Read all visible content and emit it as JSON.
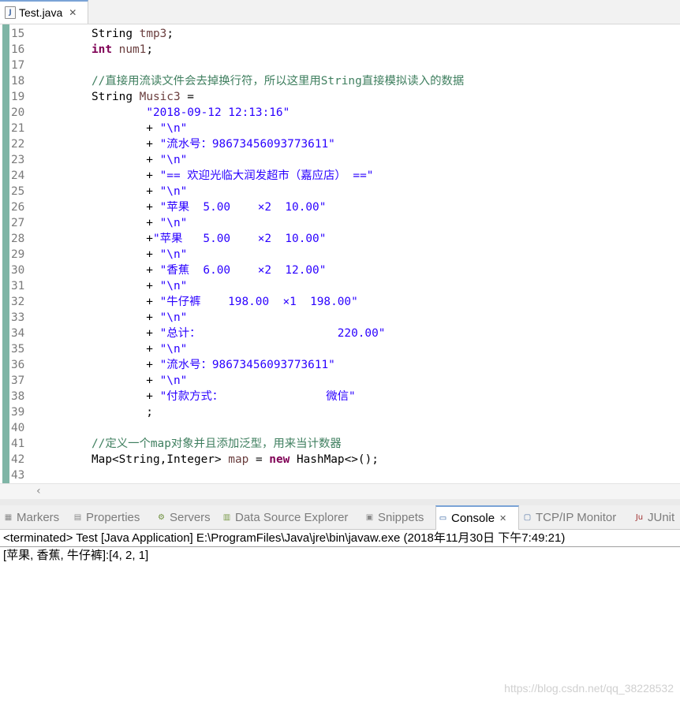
{
  "editor_tab": {
    "label": "Test.java",
    "close": "✕"
  },
  "code_lines": [
    {
      "n": "15",
      "segs": [
        {
          "t": "String ",
          "c": ""
        },
        {
          "t": "tmp3",
          "c": "fld"
        },
        {
          "t": ";",
          "c": ""
        }
      ]
    },
    {
      "n": "16",
      "segs": [
        {
          "t": "int",
          "c": "kw"
        },
        {
          "t": " ",
          "c": ""
        },
        {
          "t": "num1",
          "c": "fld"
        },
        {
          "t": ";",
          "c": ""
        }
      ]
    },
    {
      "n": "17",
      "segs": []
    },
    {
      "n": "18",
      "segs": [
        {
          "t": "//直接用流读文件会去掉换行符，所以这里用String直接模拟读入的数据",
          "c": "cmt"
        }
      ]
    },
    {
      "n": "19",
      "segs": [
        {
          "t": "String ",
          "c": ""
        },
        {
          "t": "Music3",
          "c": "fld"
        },
        {
          "t": " =",
          "c": ""
        }
      ]
    },
    {
      "n": "20",
      "segs": [
        {
          "t": "        ",
          "c": ""
        },
        {
          "t": "\"2018-09-12 12:13:16\"",
          "c": "str"
        }
      ]
    },
    {
      "n": "21",
      "segs": [
        {
          "t": "        + ",
          "c": ""
        },
        {
          "t": "\"\\n\"",
          "c": "str"
        }
      ]
    },
    {
      "n": "22",
      "segs": [
        {
          "t": "        + ",
          "c": ""
        },
        {
          "t": "\"流水号：98673456093773611\"",
          "c": "str"
        }
      ]
    },
    {
      "n": "23",
      "segs": [
        {
          "t": "        + ",
          "c": ""
        },
        {
          "t": "\"\\n\"",
          "c": "str"
        }
      ]
    },
    {
      "n": "24",
      "segs": [
        {
          "t": "        + ",
          "c": ""
        },
        {
          "t": "\"== 欢迎光临大润发超市（嘉应店） ==\"",
          "c": "str"
        }
      ]
    },
    {
      "n": "25",
      "segs": [
        {
          "t": "        + ",
          "c": ""
        },
        {
          "t": "\"\\n\"",
          "c": "str"
        }
      ]
    },
    {
      "n": "26",
      "segs": [
        {
          "t": "        + ",
          "c": ""
        },
        {
          "t": "\"苹果  5.00    ×2  10.00\"",
          "c": "str"
        }
      ]
    },
    {
      "n": "27",
      "segs": [
        {
          "t": "        + ",
          "c": ""
        },
        {
          "t": "\"\\n\"",
          "c": "str"
        }
      ]
    },
    {
      "n": "28",
      "segs": [
        {
          "t": "        +",
          "c": ""
        },
        {
          "t": "\"苹果   5.00    ×2  10.00\"",
          "c": "str"
        }
      ]
    },
    {
      "n": "29",
      "segs": [
        {
          "t": "        + ",
          "c": ""
        },
        {
          "t": "\"\\n\"",
          "c": "str"
        }
      ]
    },
    {
      "n": "30",
      "segs": [
        {
          "t": "        + ",
          "c": ""
        },
        {
          "t": "\"香蕉  6.00    ×2  12.00\"",
          "c": "str"
        }
      ]
    },
    {
      "n": "31",
      "segs": [
        {
          "t": "        + ",
          "c": ""
        },
        {
          "t": "\"\\n\"",
          "c": "str"
        }
      ]
    },
    {
      "n": "32",
      "segs": [
        {
          "t": "        + ",
          "c": ""
        },
        {
          "t": "\"牛仔裤    198.00  ×1  198.00\"",
          "c": "str"
        }
      ]
    },
    {
      "n": "33",
      "segs": [
        {
          "t": "        + ",
          "c": ""
        },
        {
          "t": "\"\\n\"",
          "c": "str"
        }
      ]
    },
    {
      "n": "34",
      "segs": [
        {
          "t": "        + ",
          "c": ""
        },
        {
          "t": "\"总计：                    220.00\"",
          "c": "str"
        }
      ]
    },
    {
      "n": "35",
      "segs": [
        {
          "t": "        + ",
          "c": ""
        },
        {
          "t": "\"\\n\"",
          "c": "str"
        }
      ]
    },
    {
      "n": "36",
      "segs": [
        {
          "t": "        + ",
          "c": ""
        },
        {
          "t": "\"流水号：98673456093773611\"",
          "c": "str"
        }
      ]
    },
    {
      "n": "37",
      "segs": [
        {
          "t": "        + ",
          "c": ""
        },
        {
          "t": "\"\\n\"",
          "c": "str"
        }
      ]
    },
    {
      "n": "38",
      "segs": [
        {
          "t": "        + ",
          "c": ""
        },
        {
          "t": "\"付款方式：               微信\"",
          "c": "str"
        }
      ]
    },
    {
      "n": "39",
      "segs": [
        {
          "t": "        ;",
          "c": ""
        }
      ]
    },
    {
      "n": "40",
      "segs": []
    },
    {
      "n": "41",
      "segs": [
        {
          "t": "//定义一个map对象并且添加泛型，用来当计数器",
          "c": "cmt"
        }
      ]
    },
    {
      "n": "42",
      "segs": [
        {
          "t": "Map<String,Integer> ",
          "c": ""
        },
        {
          "t": "map",
          "c": "fld"
        },
        {
          "t": " = ",
          "c": ""
        },
        {
          "t": "new",
          "c": "kw"
        },
        {
          "t": " HashMap<>();",
          "c": ""
        }
      ]
    },
    {
      "n": "43",
      "segs": []
    }
  ],
  "views": {
    "tabs": [
      {
        "label": "Markers",
        "icon": "markers-icon",
        "glyph": "▦",
        "color": "#8a8a8a"
      },
      {
        "label": "Properties",
        "icon": "properties-icon",
        "glyph": "▤",
        "color": "#8a8a8a"
      },
      {
        "label": "Servers",
        "icon": "servers-icon",
        "glyph": "⚙",
        "color": "#6b8e3a"
      },
      {
        "label": "Data Source Explorer",
        "icon": "data-source-icon",
        "glyph": "▥",
        "color": "#7a9a4a"
      },
      {
        "label": "Snippets",
        "icon": "snippets-icon",
        "glyph": "▣",
        "color": "#8a8a8a"
      },
      {
        "label": "Console",
        "icon": "console-icon",
        "glyph": "▭",
        "color": "#2f5f9f",
        "close": "✕"
      },
      {
        "label": "TCP/IP Monitor",
        "icon": "tcpip-monitor-icon",
        "glyph": "▢",
        "color": "#5a7aa8"
      },
      {
        "label": "JUnit",
        "icon": "junit-icon",
        "glyph": "Ju",
        "color": "#a03030"
      }
    ]
  },
  "console": {
    "header": "<terminated> Test [Java Application] E:\\ProgramFiles\\Java\\jre\\bin\\javaw.exe (2018年11月30日 下午7:49:21)",
    "output": "[苹果, 香蕉, 牛仔裤]:[4, 2, 1]"
  },
  "watermark": "https://blog.csdn.net/qq_38228532",
  "colors": {
    "keyword": "#7f0055",
    "string": "#2a00ff",
    "comment": "#3f7f5f",
    "field": "#6a3e3e",
    "gutter": "#7fb5a6"
  }
}
